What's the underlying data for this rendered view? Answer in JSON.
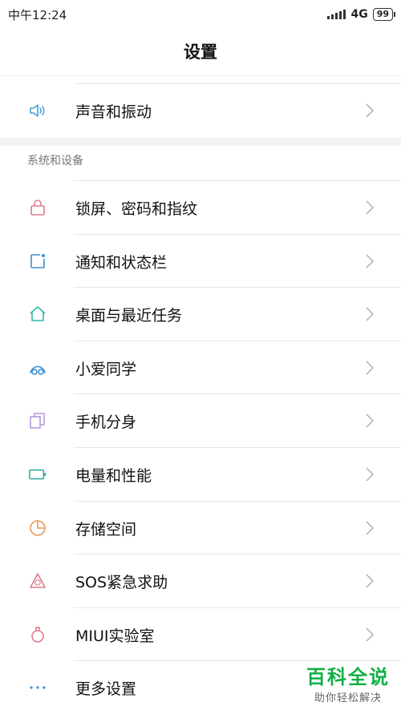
{
  "status": {
    "time": "中午12:24",
    "network": "4G",
    "network_sup": "..",
    "battery": "99"
  },
  "header": {
    "title": "设置"
  },
  "top_group": {
    "items": [
      {
        "label": "声音和振动",
        "icon": "speaker-icon",
        "color": "#4a9fd8"
      }
    ]
  },
  "system_section": {
    "title": "系统和设备",
    "items": [
      {
        "label": "锁屏、密码和指纹",
        "icon": "lock-icon",
        "color": "#e07a8a"
      },
      {
        "label": "通知和状态栏",
        "icon": "notification-icon",
        "color": "#3b8fd6"
      },
      {
        "label": "桌面与最近任务",
        "icon": "home-icon",
        "color": "#32b7a8"
      },
      {
        "label": "小爱同学",
        "icon": "xiaoai-icon",
        "color": "#3b8fd6"
      },
      {
        "label": "手机分身",
        "icon": "second-space-icon",
        "color": "#b79ad8"
      },
      {
        "label": "电量和性能",
        "icon": "battery-icon",
        "color": "#22a89a"
      },
      {
        "label": "存储空间",
        "icon": "storage-icon",
        "color": "#e39a5a"
      },
      {
        "label": "SOS紧急求助",
        "icon": "sos-icon",
        "color": "#e07a8a"
      },
      {
        "label": "MIUI实验室",
        "icon": "lab-icon",
        "color": "#e07a8a"
      },
      {
        "label": "更多设置",
        "icon": "more-icon",
        "color": "#3b8fd6"
      }
    ]
  },
  "watermark": {
    "line1": "百科全说",
    "line2": "助你轻松解决"
  }
}
